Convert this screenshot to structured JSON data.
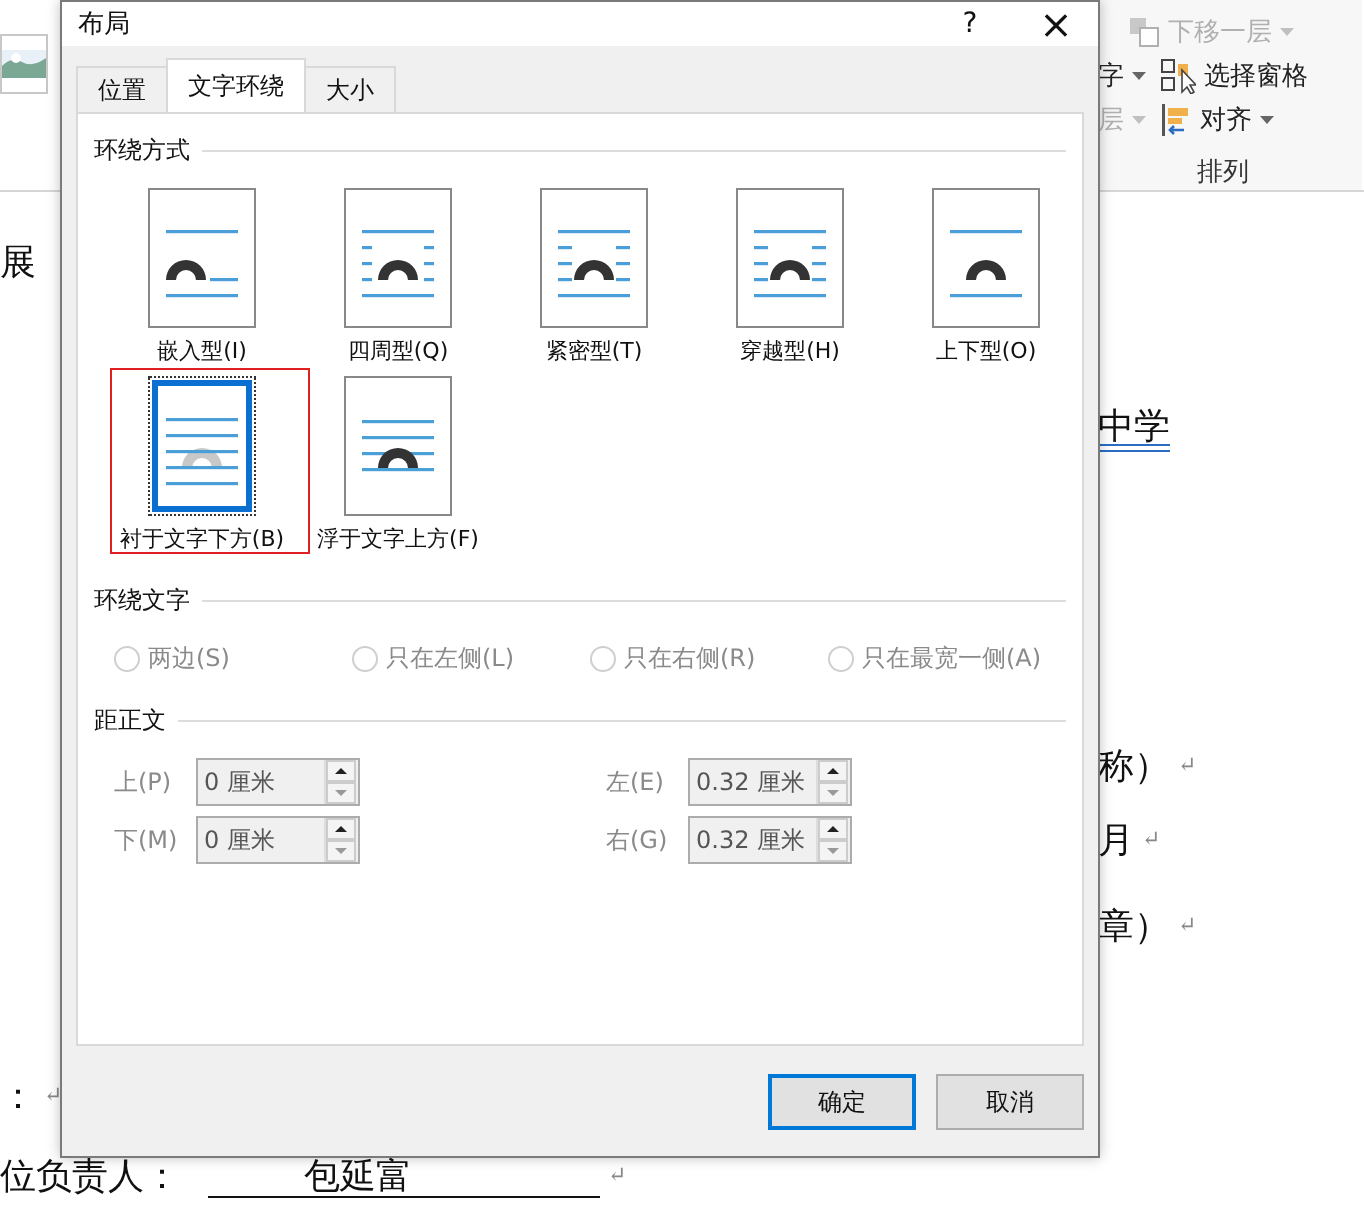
{
  "ribbon": {
    "rows": [
      {
        "items": [
          {
            "label": "下移一层",
            "disabled": true,
            "dropdown": true
          }
        ]
      },
      {
        "items": [
          {
            "label": "字",
            "disabled": false,
            "dropdown": true
          },
          {
            "label": "选择窗格",
            "disabled": false,
            "dropdown": false
          }
        ]
      },
      {
        "items": [
          {
            "label": "层",
            "disabled": true,
            "dropdown": true
          },
          {
            "label": "对齐",
            "disabled": false,
            "dropdown": true
          }
        ]
      }
    ],
    "group_label": "排列"
  },
  "document": {
    "left_column": [
      {
        "kind": "text",
        "text": "展"
      },
      {
        "kind": "text",
        "text": "：",
        "mark": "↵"
      },
      {
        "kind": "blank",
        "label": "位负责人：",
        "value": "包延富",
        "mark": "↵"
      }
    ],
    "right_column": [
      {
        "text": "中学",
        "underlined": true
      },
      {
        "text": "称）",
        "mark": "↵",
        "underlined": false
      },
      {
        "text": "月",
        "mark": "↵",
        "underlined": false
      },
      {
        "text": "章）",
        "mark": "↵",
        "underlined": false
      }
    ]
  },
  "dialog": {
    "title": "布局",
    "help_button": "?",
    "close_button": "×",
    "tabs": [
      {
        "label": "位置",
        "selected": false
      },
      {
        "label": "文字环绕",
        "selected": true
      },
      {
        "label": "大小",
        "selected": false
      }
    ],
    "wrap_style": {
      "heading": "环绕方式",
      "options": [
        {
          "kind": "inline",
          "label": "嵌入型(I)",
          "selected": false,
          "annotated": false
        },
        {
          "kind": "square",
          "label": "四周型(Q)",
          "selected": false,
          "annotated": false
        },
        {
          "kind": "tight",
          "label": "紧密型(T)",
          "selected": false,
          "annotated": false
        },
        {
          "kind": "through",
          "label": "穿越型(H)",
          "selected": false,
          "annotated": false
        },
        {
          "kind": "topbottom",
          "label": "上下型(O)",
          "selected": false,
          "annotated": false
        },
        {
          "kind": "behind",
          "label": "衬于文字下方(B)",
          "selected": true,
          "annotated": true
        },
        {
          "kind": "front",
          "label": "浮于文字上方(F)",
          "selected": false,
          "annotated": false
        }
      ]
    },
    "wrap_text": {
      "heading": "环绕文字",
      "options": [
        {
          "label": "两边(S)",
          "selected": false,
          "disabled": true
        },
        {
          "label": "只在左侧(L)",
          "selected": false,
          "disabled": true
        },
        {
          "label": "只在右侧(R)",
          "selected": false,
          "disabled": true
        },
        {
          "label": "只在最宽一侧(A)",
          "selected": false,
          "disabled": true
        }
      ]
    },
    "distance": {
      "heading": "距正文",
      "fields": [
        {
          "label": "上(P)",
          "value": "0 厘米",
          "disabled": true
        },
        {
          "label": "左(E)",
          "value": "0.32 厘米",
          "disabled": true
        },
        {
          "label": "下(M)",
          "value": "0 厘米",
          "disabled": true
        },
        {
          "label": "右(G)",
          "value": "0.32 厘米",
          "disabled": true
        }
      ]
    },
    "buttons": [
      {
        "label": "确定",
        "default": true
      },
      {
        "label": "取消",
        "default": false
      }
    ]
  }
}
